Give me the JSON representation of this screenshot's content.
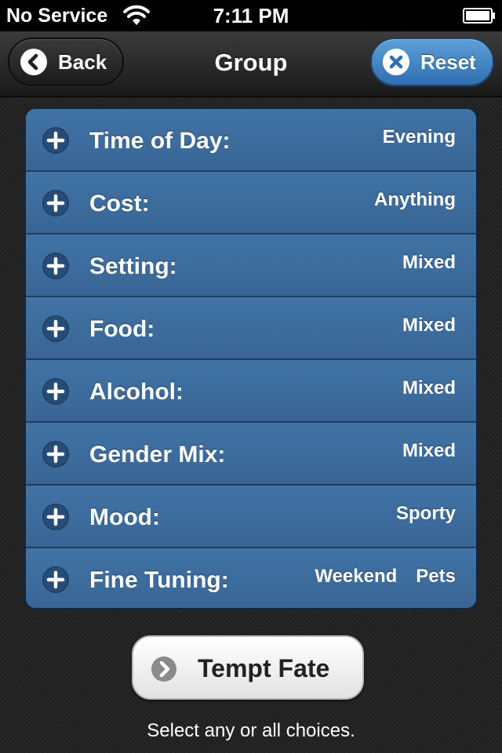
{
  "status_bar": {
    "carrier": "No Service",
    "time": "7:11 PM",
    "wifi_icon": "wifi-icon",
    "battery_icon": "battery-icon"
  },
  "nav": {
    "title": "Group",
    "back_label": "Back",
    "reset_label": "Reset",
    "back_icon": "chevron-left-icon",
    "reset_icon": "close-icon"
  },
  "options": [
    {
      "label": "Time of Day:",
      "value": "Evening"
    },
    {
      "label": "Cost:",
      "value": "Anything"
    },
    {
      "label": "Setting:",
      "value": "Mixed"
    },
    {
      "label": "Food:",
      "value": "Mixed"
    },
    {
      "label": "Alcohol:",
      "value": "Mixed"
    },
    {
      "label": "Gender Mix:",
      "value": "Mixed"
    },
    {
      "label": "Mood:",
      "value": "Sporty"
    },
    {
      "label": "Fine Tuning:",
      "value_tags": [
        "Weekend",
        "Pets"
      ]
    }
  ],
  "tempt": {
    "label": "Tempt Fate",
    "icon": "chevron-right-icon"
  },
  "hint": "Select any or all choices.",
  "colors": {
    "row_blue": "#3c6a9c",
    "reset_blue": "#4583c4",
    "background": "#202020"
  }
}
